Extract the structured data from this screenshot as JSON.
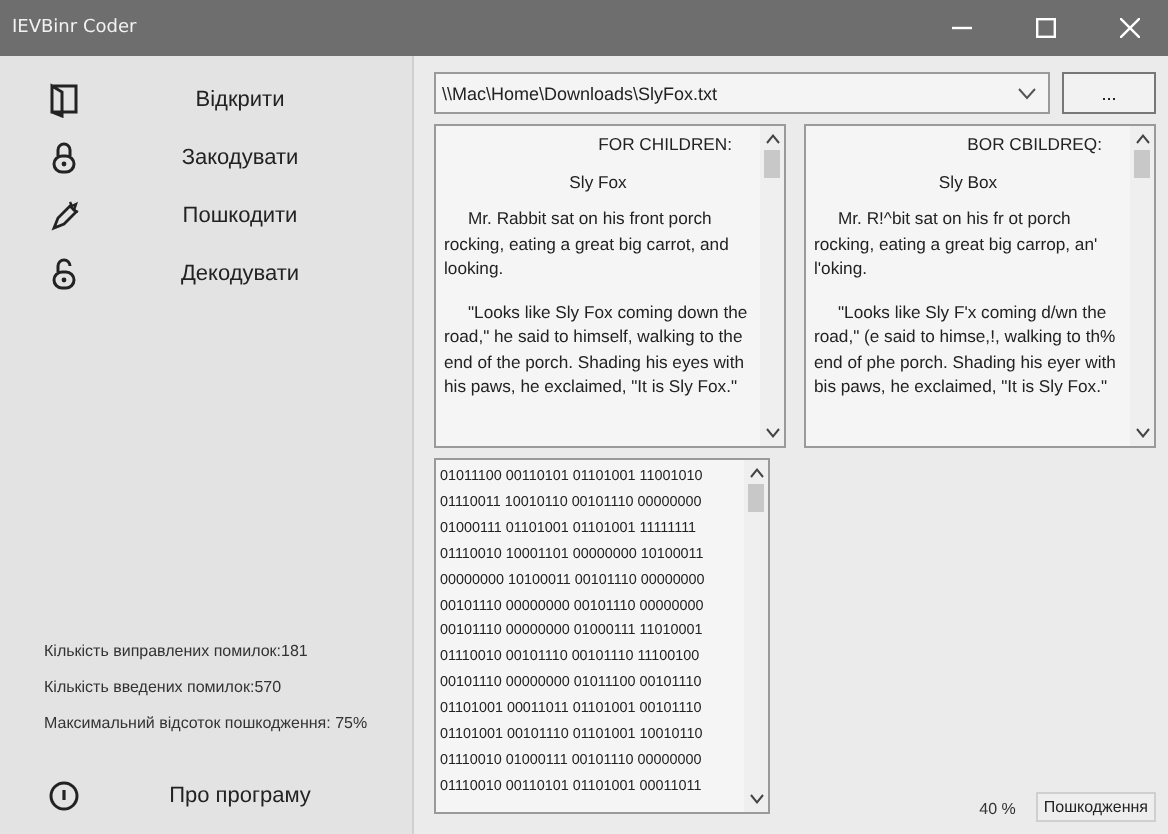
{
  "window": {
    "title": "IEVBinr Coder"
  },
  "sidebar": {
    "items": [
      {
        "kind": "open",
        "label": "Відкрити"
      },
      {
        "kind": "encode",
        "label": "Закодувати"
      },
      {
        "kind": "damage",
        "label": "Пошкодити"
      },
      {
        "kind": "decode",
        "label": "Декодувати"
      }
    ],
    "stats": [
      "Кількість виправлених помилок:181",
      "Кількість введених помилок:570",
      "Максимальний відсоток пошкодження: 75%"
    ],
    "about": {
      "kind": "info",
      "label": "Про програму"
    }
  },
  "file_path": {
    "value": "\\\\Mac\\Home\\Downloads\\SlyFox.txt"
  },
  "browse_button": "...",
  "original_text": [
    {
      "kind": "heading",
      "text": "FOR CHILDREN:"
    },
    {
      "kind": "title",
      "text": "Sly Fox"
    },
    {
      "kind": "body",
      "text": "Mr. Rabbit sat on his front porch rocking, eating a great big carrot, and looking."
    },
    {
      "kind": "body",
      "text": "\"Looks like Sly Fox coming down the road,\" he said to himself, walking to the end of the porch. Shading his eyes with his paws, he exclaimed, \"It is Sly Fox.\""
    }
  ],
  "damaged_text": [
    {
      "kind": "heading",
      "text": "BOR CBILDREQ:"
    },
    {
      "kind": "title",
      "text": "Sly Box"
    },
    {
      "kind": "body",
      "text": "Mr. R!^bit sat on his fr ot porch rocking, eating a great big carrop, an' l'oking."
    },
    {
      "kind": "body",
      "text": "\"Looks like Sly F'x coming d/wn the road,\" (e said to himse,!, walking to th% end of phe porch. Shading his eyer with bis paws, he exclaimed, \"It is Sly Fox.\""
    }
  ],
  "binary_rows": [
    "01011100 00110101 01101001 11001010",
    "01110011 10010110 00101110 00000000",
    "01000111 01101001 01101001 11111111",
    "01110010 10001101 00000000 10100011",
    "00000000 10100011 00101110 00000000",
    "00101110 00000000 00101110 00000000",
    "00101110 00000000 01000111 11010001",
    "01110010 00101110 00101110 11100100",
    "00101110 00000000 01011100 00101110",
    "01101001 00011011 01101001 00101110",
    "01101001 00101110 01101001 10010110",
    "01110010 01000111 00101110 00000000",
    "01110010 00110101 01101001 00011011"
  ],
  "damage_percent": "40 %",
  "damage_button": "Пошкодження"
}
